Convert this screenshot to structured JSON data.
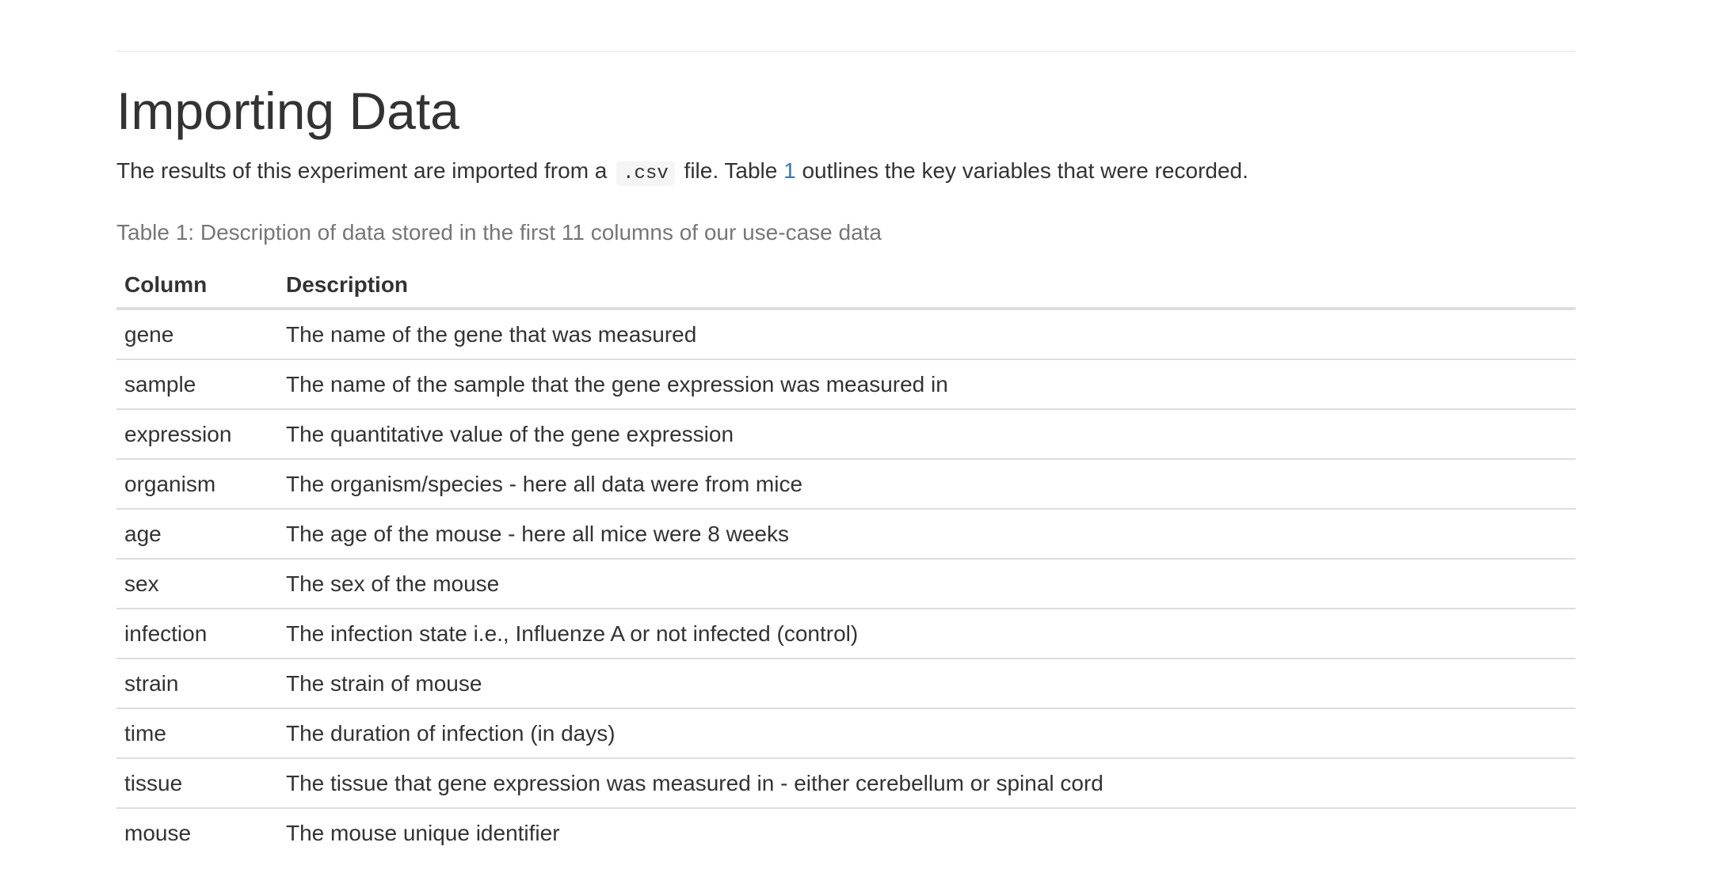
{
  "page": {
    "title": "Importing Data"
  },
  "intro": {
    "before_code": "The results of this experiment are imported from a ",
    "code": ".csv",
    "after_code": " file. Table ",
    "table_ref": "1",
    "after_ref": " outlines the key variables that were recorded."
  },
  "table": {
    "caption": "Table 1: Description of data stored in the first 11 columns of our use-case data",
    "headers": [
      "Column",
      "Description"
    ],
    "rows": [
      {
        "column": "gene",
        "description": "The name of the gene that was measured"
      },
      {
        "column": "sample",
        "description": "The name of the sample that the gene expression was measured in"
      },
      {
        "column": "expression",
        "description": "The quantitative value of the gene expression"
      },
      {
        "column": "organism",
        "description": "The organism/species - here all data were from mice"
      },
      {
        "column": "age",
        "description": "The age of the mouse - here all mice were 8 weeks"
      },
      {
        "column": "sex",
        "description": "The sex of the mouse"
      },
      {
        "column": "infection",
        "description": "The infection state i.e., Influenze A or not infected (control)"
      },
      {
        "column": "strain",
        "description": "The strain of mouse"
      },
      {
        "column": "time",
        "description": "The duration of infection (in days)"
      },
      {
        "column": "tissue",
        "description": "The tissue that gene expression was measured in - either cerebellum or spinal cord"
      },
      {
        "column": "mouse",
        "description": "The mouse unique identifier"
      }
    ]
  },
  "colors": {
    "text": "#333333",
    "caption": "#777777",
    "link": "#337ab7",
    "rule": "#dddddd"
  }
}
